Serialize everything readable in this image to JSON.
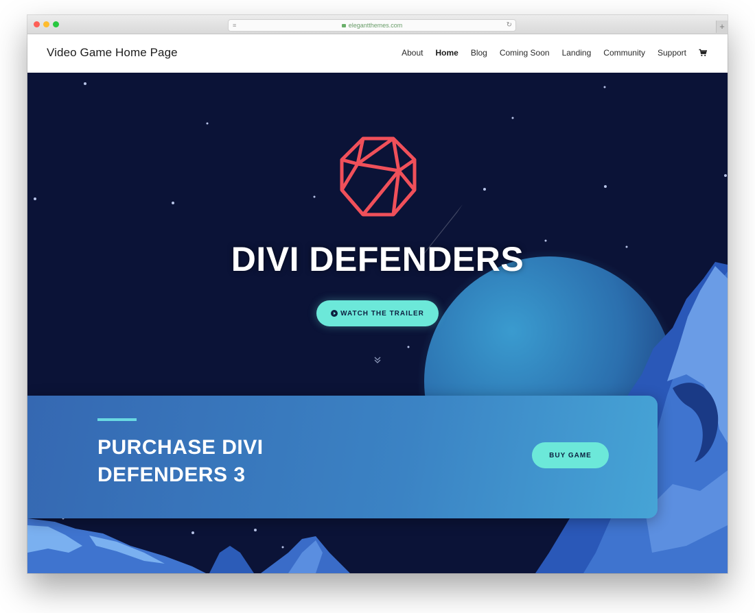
{
  "browser": {
    "address": "elegantthemes.com",
    "new_tab_label": "+"
  },
  "site": {
    "title": "Video Game Home Page",
    "nav": [
      {
        "label": "About",
        "active": false
      },
      {
        "label": "Home",
        "active": true
      },
      {
        "label": "Blog",
        "active": false
      },
      {
        "label": "Coming Soon",
        "active": false
      },
      {
        "label": "Landing",
        "active": false
      },
      {
        "label": "Community",
        "active": false
      },
      {
        "label": "Support",
        "active": false
      }
    ],
    "cart_icon": "cart-icon"
  },
  "hero": {
    "title": "DIVI DEFENDERS",
    "trailer_button": "WATCH THE TRAILER",
    "play_icon": "play-circle-icon",
    "scroll_icon": "double-chevron-down-icon",
    "logo_icon": "geodesic-sphere-logo",
    "colors": {
      "sky": "#0b1337",
      "planet": "#3a9bcf",
      "mountains": "#3f74cf",
      "accent": "#6ce8d9",
      "logo": "#f0505a"
    }
  },
  "purchase": {
    "title_line1": "PURCHASE DIVI",
    "title_line2": "DEFENDERS 3",
    "buy_button": "BUY GAME"
  }
}
